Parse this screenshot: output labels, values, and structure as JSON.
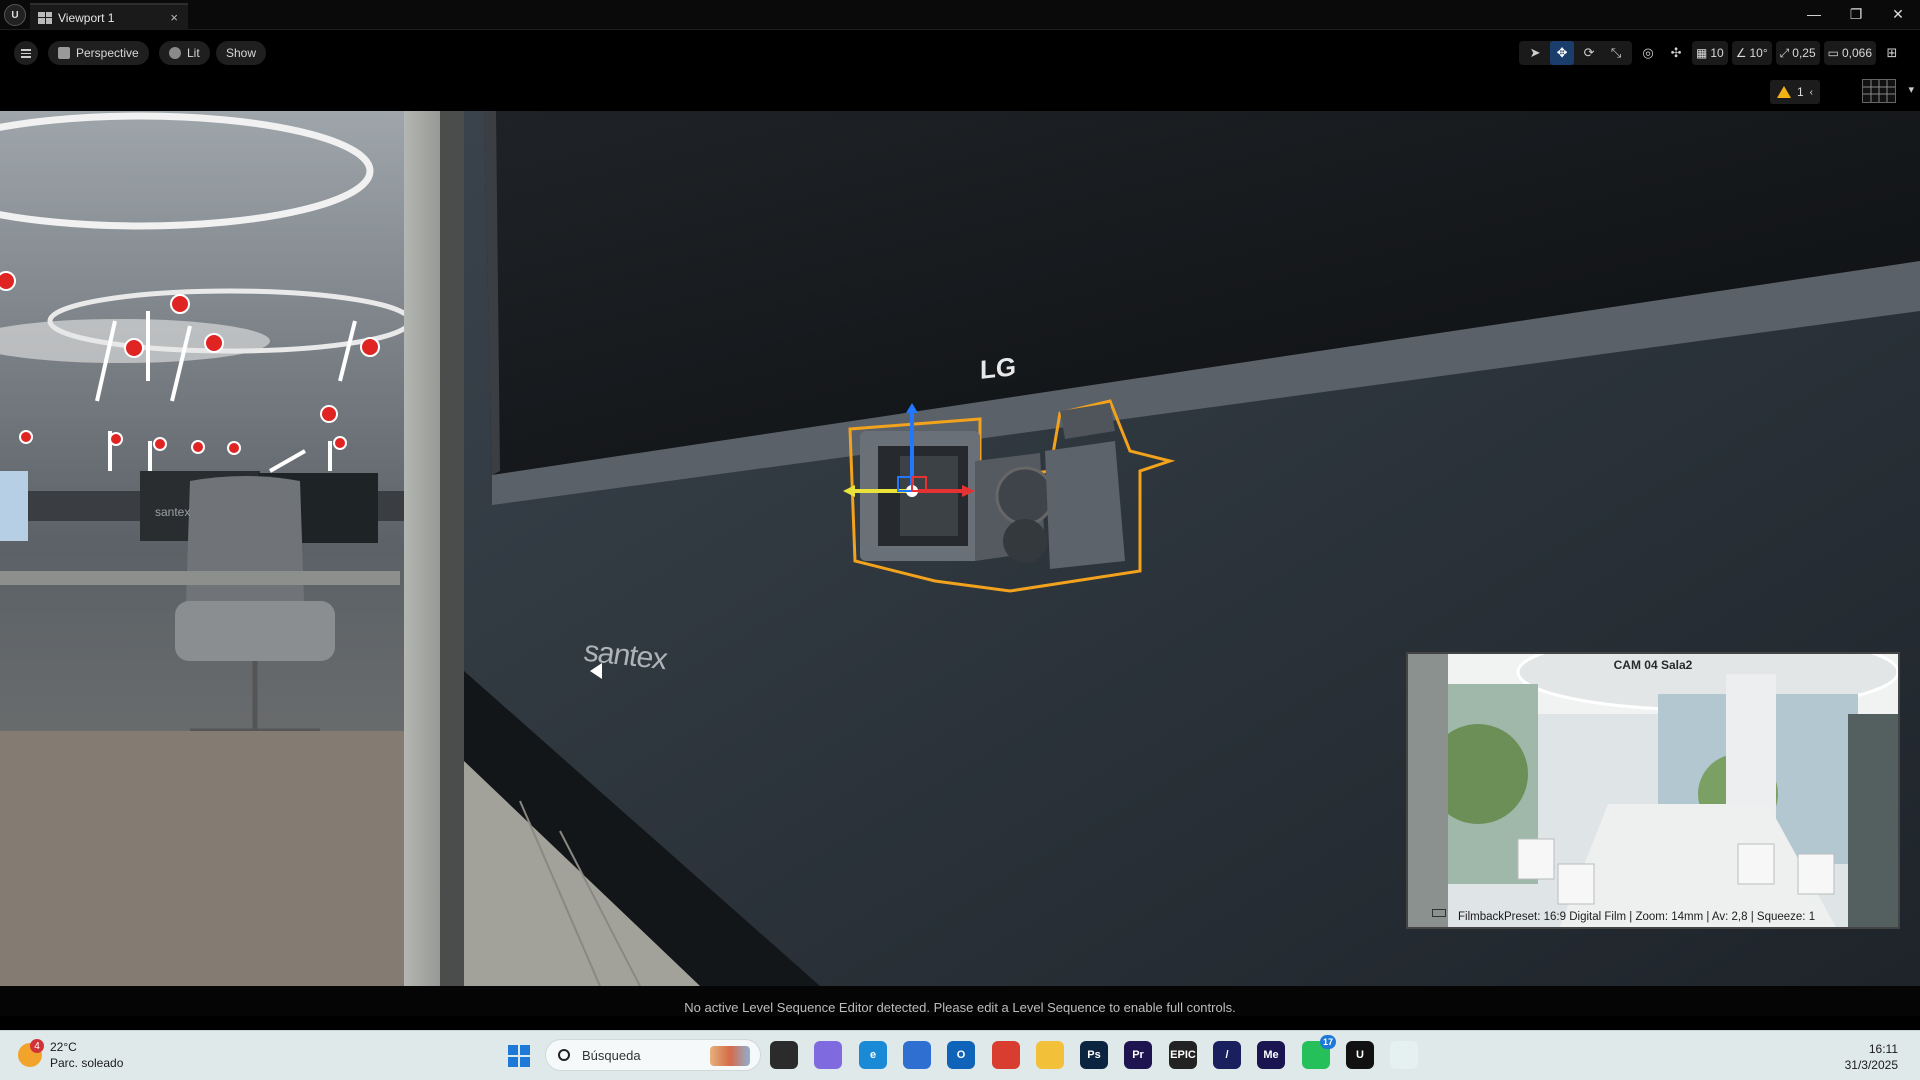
{
  "app": {
    "logo_text": "U",
    "tab_title": "Viewport 1",
    "tab_close": "×",
    "window_controls": {
      "minimize": "—",
      "restore": "❐",
      "close": "✕"
    }
  },
  "toolbar": {
    "view_mode": "Perspective",
    "lighting": "Lit",
    "show": "Show",
    "grid_snap": "10",
    "rotation_snap": "10°",
    "scale_snap": "0,25",
    "camera_speed": "0,066",
    "warning_count": "1",
    "icons": [
      "select-icon",
      "translate-icon",
      "rotate-icon",
      "scale-icon",
      "world-local-icon",
      "surface-snap-icon",
      "grid-snap-icon",
      "rotation-snap-icon",
      "scale-snap-icon",
      "camera-speed-icon",
      "maximize-icon",
      "layout-icon"
    ]
  },
  "scene": {
    "monitor_brand": "LG",
    "wall_brand": "santex",
    "office_brand": "santex",
    "selection_color": "#f2a21c"
  },
  "pip": {
    "title": "CAM 04 Sala2",
    "info": "FilmbackPreset: 16:9 Digital Film | Zoom: 14mm | Av: 2,8 | Squeeze: 1"
  },
  "status": {
    "message": "No active Level Sequence Editor detected. Please edit a Level Sequence to enable full controls."
  },
  "taskbar": {
    "weather_badge": "4",
    "temperature": "22°C",
    "condition": "Parc. soleado",
    "search_placeholder": "Búsqueda",
    "apps": [
      {
        "name": "task-view",
        "label": "",
        "color": "#2b2b2b"
      },
      {
        "name": "copilot",
        "label": "",
        "color": "#7f6ae0"
      },
      {
        "name": "edge",
        "label": "e",
        "color": "#1b8ad6"
      },
      {
        "name": "store",
        "label": "",
        "color": "#2f6fd1"
      },
      {
        "name": "outlook",
        "label": "O",
        "color": "#0f63b8"
      },
      {
        "name": "chrome",
        "label": "",
        "color": "#d93d2f"
      },
      {
        "name": "explorer",
        "label": "",
        "color": "#f3c03a"
      },
      {
        "name": "photoshop",
        "label": "Ps",
        "color": "#0b2540"
      },
      {
        "name": "premiere",
        "label": "Pr",
        "color": "#1e1450"
      },
      {
        "name": "epic",
        "label": "EPIC",
        "color": "#222"
      },
      {
        "name": "pen",
        "label": "/",
        "color": "#1a1f5e"
      },
      {
        "name": "media-encoder",
        "label": "Me",
        "color": "#1a1450"
      },
      {
        "name": "whatsapp",
        "label": "",
        "color": "#25c05a",
        "badge": "17"
      },
      {
        "name": "unreal",
        "label": "U",
        "color": "#111"
      },
      {
        "name": "snipping",
        "label": "",
        "color": "#e5f0f0"
      }
    ],
    "time": "16:11",
    "date": "31/3/2025"
  }
}
